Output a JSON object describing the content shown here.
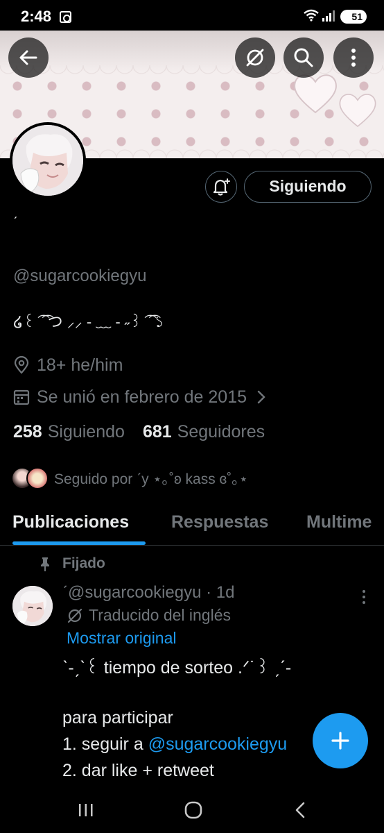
{
  "status_bar": {
    "time": "2:48",
    "battery": "51"
  },
  "profile": {
    "display_name": "ˊ",
    "handle": "@sugarcookiegyu",
    "bio": "໒꒰ ͡ ͡ つ ⸝⸝ - ﹏ - ˶꒱ ͡ ͡ ১",
    "location": "18+ he/him",
    "joined": "Se unió en febrero de 2015",
    "following_count": "258",
    "following_label": "Siguiendo",
    "followers_count": "681",
    "followers_label": "Seguidores",
    "followed_by": "Seguido por ˊy ⋆｡˚ʚ kass ɞ˚｡⋆"
  },
  "actions": {
    "follow_state": "Siguiendo"
  },
  "tabs": [
    {
      "label": "Publicaciones",
      "active": true
    },
    {
      "label": "Respuestas",
      "active": false
    },
    {
      "label": "Multime",
      "active": false
    }
  ],
  "post": {
    "pinned_label": "Fijado",
    "header": "ˊ@sugarcookiegyu · 1d",
    "translated_label": "Traducido del inglés",
    "show_original": "Mostrar original",
    "line1": "ˋ-ˏˋ꒰ tiempo de sorteo .ᐟ˙꒱ ˏˊ-",
    "line2": "para participar",
    "line3_prefix": "1. seguir a ",
    "line3_mention": "@sugarcookiegyu",
    "line4": "2. dar like + retweet"
  },
  "colors": {
    "accent": "#1d9bf0",
    "background": "#000000",
    "secondary_text": "#71767b",
    "primary_text": "#e7e9ea"
  }
}
